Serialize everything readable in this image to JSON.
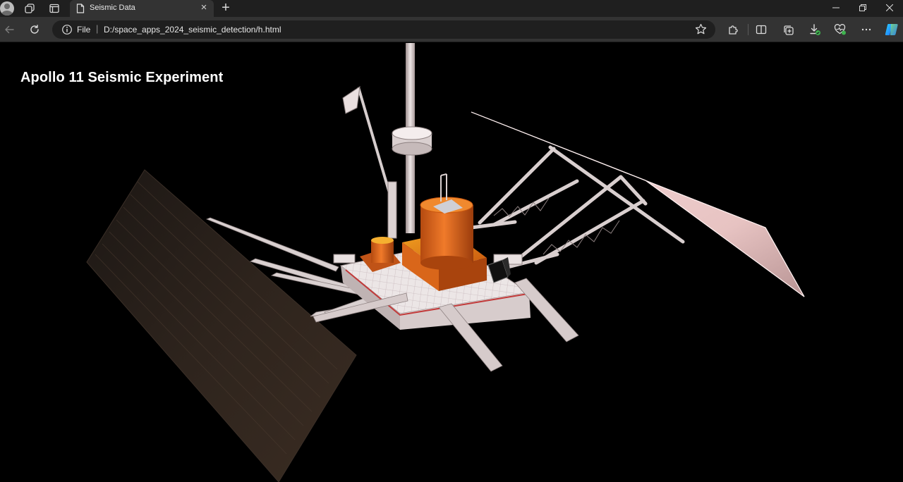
{
  "browser": {
    "tab": {
      "title": "Seismic Data",
      "close_glyph": "×"
    },
    "new_tab_glyph": "+",
    "window_controls": {
      "minimize": "—",
      "restore": "❐",
      "close": "✕"
    },
    "address": {
      "scheme_label": "File",
      "separator": "|",
      "url": "D:/space_apps_2024_seismic_detection/h.html"
    },
    "icons": {
      "profile": "avatar-icon",
      "workspaces": "workspaces-icon",
      "tab_actions": "tab-actions-icon",
      "page": "page-icon",
      "back": "back-arrow-icon",
      "refresh": "refresh-icon",
      "info": "info-icon",
      "favorite": "star-icon",
      "extensions": "puzzle-icon",
      "split_screen": "split-screen-icon",
      "collections": "collections-icon",
      "downloads": "download-icon",
      "browser_essentials": "heart-pulse-icon",
      "more": "more-dots-icon",
      "copilot": "copilot-icon"
    }
  },
  "page": {
    "title": "Apollo 11 Seismic Experiment"
  },
  "colors": {
    "tab_strip": "#1f1f1f",
    "toolbar": "#333333",
    "omnibox": "#1f1f1f",
    "page_background": "#000000",
    "solar_panel_dark": "#2a221c",
    "solar_panel_light": "#e6c2c2",
    "instrument_orange": "#d9641a",
    "deck_white": "#e9e3e3"
  }
}
